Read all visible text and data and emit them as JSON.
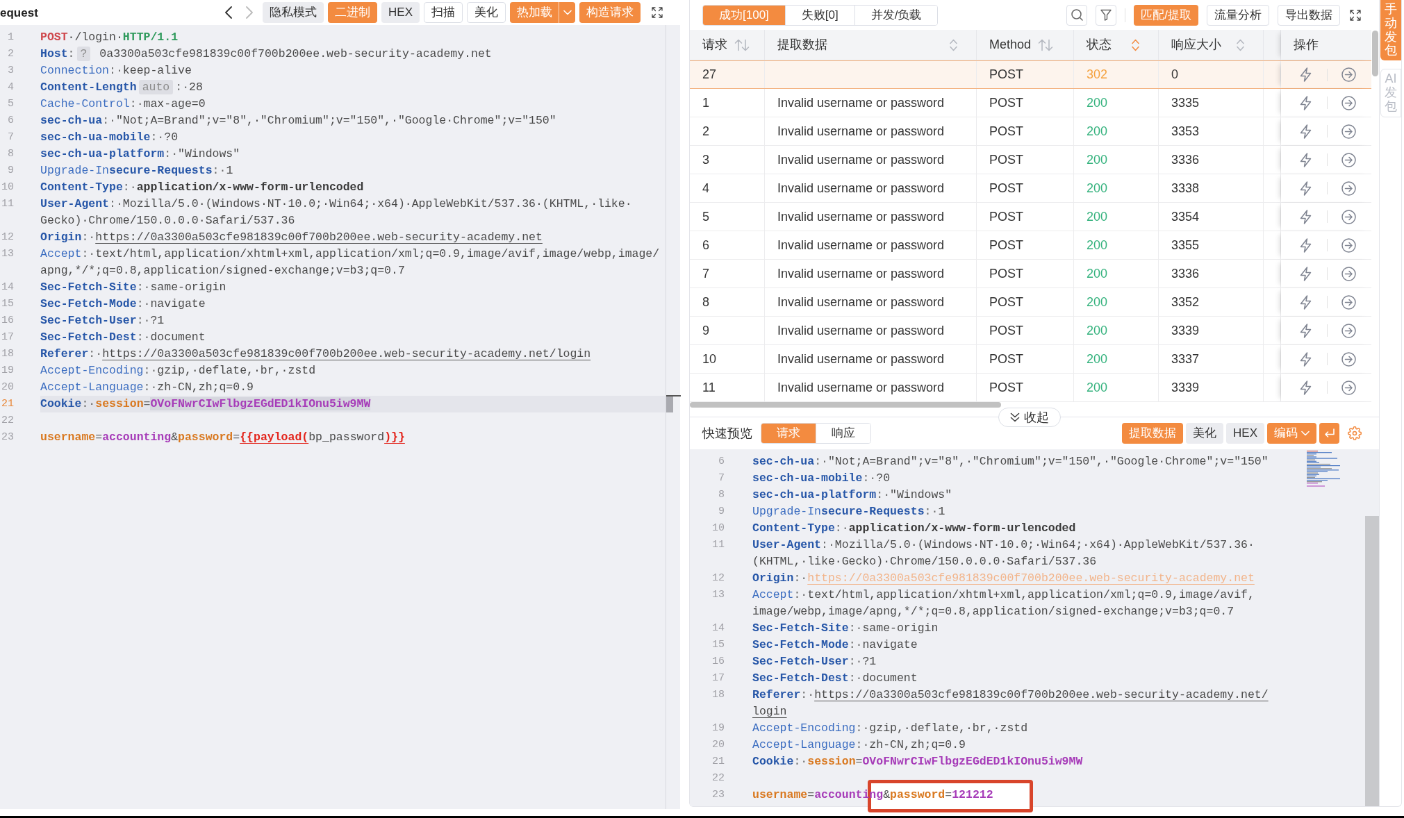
{
  "request_editor": {
    "title": "equest",
    "history": {
      "back_enabled": true,
      "forward_enabled": false
    },
    "toolbar": [
      {
        "label": "隐私模式",
        "kind": "gray"
      },
      {
        "label": "二进制",
        "kind": "primary"
      },
      {
        "label": "HEX",
        "kind": "gray"
      },
      {
        "label": "扫描",
        "kind": "outline"
      },
      {
        "label": "美化",
        "kind": "outline"
      },
      {
        "label": "热加载",
        "kind": "split"
      },
      {
        "label": "构造请求",
        "kind": "primary"
      }
    ],
    "lines": [
      {
        "number": "1",
        "active": false,
        "rows": [
          [
            {
              "text": "POST",
              "kind": "method"
            },
            {
              "text": "·/login·",
              "kind": "text"
            },
            {
              "text": "HTTP/1.1",
              "kind": "version"
            }
          ]
        ]
      },
      {
        "number": "2",
        "active": false,
        "rows": [
          [
            {
              "text": "Host",
              "kind": "keybold"
            },
            {
              "text": ":",
              "kind": "punct"
            },
            {
              "text": "?",
              "kind": "chip"
            },
            {
              "text": " 0a3300a503cfe981839c00f700b200ee.web-security-academy.net",
              "kind": "text"
            }
          ]
        ]
      },
      {
        "number": "3",
        "active": false,
        "rows": [
          [
            {
              "text": "Connection",
              "kind": "key"
            },
            {
              "text": ":·",
              "kind": "punct"
            },
            {
              "text": "keep-alive",
              "kind": "text"
            }
          ]
        ]
      },
      {
        "number": "4",
        "active": false,
        "rows": [
          [
            {
              "text": "Content-Length",
              "kind": "keybold"
            },
            {
              "text": "auto",
              "kind": "chip"
            },
            {
              "text": ":·",
              "kind": "punct"
            },
            {
              "text": "28",
              "kind": "text"
            }
          ]
        ]
      },
      {
        "number": "5",
        "active": false,
        "rows": [
          [
            {
              "text": "Cache-Control",
              "kind": "key"
            },
            {
              "text": ":·",
              "kind": "punct"
            },
            {
              "text": "max-age=0",
              "kind": "text"
            }
          ]
        ]
      },
      {
        "number": "6",
        "active": false,
        "rows": [
          [
            {
              "text": "sec-ch-ua",
              "kind": "keybold"
            },
            {
              "text": ":·",
              "kind": "punct"
            },
            {
              "text": "\"Not;A=Brand\";v=\"8\",·\"Chromium\";v=\"150\",·\"Google·Chrome\";v=\"150\"",
              "kind": "text"
            }
          ]
        ]
      },
      {
        "number": "7",
        "active": false,
        "rows": [
          [
            {
              "text": "sec-ch-ua-mobile",
              "kind": "keybold"
            },
            {
              "text": ":·",
              "kind": "punct"
            },
            {
              "text": "?0",
              "kind": "text"
            }
          ]
        ]
      },
      {
        "number": "8",
        "active": false,
        "rows": [
          [
            {
              "text": "sec-ch-ua-platform",
              "kind": "keybold"
            },
            {
              "text": ":·",
              "kind": "punct"
            },
            {
              "text": "\"Windows\"",
              "kind": "text"
            }
          ]
        ]
      },
      {
        "number": "9",
        "active": false,
        "rows": [
          [
            {
              "text": "Upgrade-In",
              "kind": "key"
            },
            {
              "text": "secure-Requests",
              "kind": "keybold"
            },
            {
              "text": ":·",
              "kind": "punct"
            },
            {
              "text": "1",
              "kind": "text"
            }
          ]
        ]
      },
      {
        "number": "10",
        "active": false,
        "rows": [
          [
            {
              "text": "Content-Type",
              "kind": "keybold"
            },
            {
              "text": ":·",
              "kind": "punct"
            },
            {
              "text": "application/x-www-form-urlencoded",
              "kind": "strong"
            }
          ]
        ]
      },
      {
        "number": "11",
        "active": false,
        "rows": [
          [
            {
              "text": "User-Agent",
              "kind": "keybold"
            },
            {
              "text": ":·",
              "kind": "punct"
            },
            {
              "text": "Mozilla/5.0·(Windows·NT·10.0;·Win64;·x64)·AppleWebKit/537.36·(KHTML,·like·",
              "kind": "text"
            }
          ],
          [
            {
              "text": "Gecko)·Chrome/150.0.0.0·Safari/537.36",
              "kind": "text"
            }
          ]
        ]
      },
      {
        "number": "12",
        "active": false,
        "rows": [
          [
            {
              "text": "Origin",
              "kind": "keybold"
            },
            {
              "text": ":·",
              "kind": "punct"
            },
            {
              "text": "https://0a3300a503cfe981839c00f700b200ee.web-security-academy.net",
              "kind": "link"
            }
          ]
        ]
      },
      {
        "number": "13",
        "active": false,
        "rows": [
          [
            {
              "text": "Accept",
              "kind": "key"
            },
            {
              "text": ":·",
              "kind": "punct"
            },
            {
              "text": "text/html,application/xhtml+xml,application/xml;q=0.9,image/avif,image/webp,image/",
              "kind": "text"
            }
          ],
          [
            {
              "text": "apng,*/*;q=0.8,application/signed-exchange;v=b3;q=0.7",
              "kind": "text"
            }
          ]
        ]
      },
      {
        "number": "14",
        "active": false,
        "rows": [
          [
            {
              "text": "Sec-Fetch-Site",
              "kind": "keybold"
            },
            {
              "text": ":·",
              "kind": "punct"
            },
            {
              "text": "same-origin",
              "kind": "text"
            }
          ]
        ]
      },
      {
        "number": "15",
        "active": false,
        "rows": [
          [
            {
              "text": "Sec-Fetch-Mode",
              "kind": "keybold"
            },
            {
              "text": ":·",
              "kind": "punct"
            },
            {
              "text": "navigate",
              "kind": "text"
            }
          ]
        ]
      },
      {
        "number": "16",
        "active": false,
        "rows": [
          [
            {
              "text": "Sec-Fetch-User",
              "kind": "keybold"
            },
            {
              "text": ":·",
              "kind": "punct"
            },
            {
              "text": "?1",
              "kind": "text"
            }
          ]
        ]
      },
      {
        "number": "17",
        "active": false,
        "rows": [
          [
            {
              "text": "Sec-Fetch-Dest",
              "kind": "keybold"
            },
            {
              "text": ":·",
              "kind": "punct"
            },
            {
              "text": "document",
              "kind": "text"
            }
          ]
        ]
      },
      {
        "number": "18",
        "active": false,
        "rows": [
          [
            {
              "text": "Referer",
              "kind": "keybold"
            },
            {
              "text": ":·",
              "kind": "punct"
            },
            {
              "text": "https://0a3300a503cfe981839c00f700b200ee.web-security-academy.net/login",
              "kind": "link"
            }
          ]
        ]
      },
      {
        "number": "19",
        "active": false,
        "rows": [
          [
            {
              "text": "Accept-Encoding",
              "kind": "key"
            },
            {
              "text": ":·",
              "kind": "punct"
            },
            {
              "text": "gzip,·deflate,·br,·zstd",
              "kind": "text"
            }
          ]
        ]
      },
      {
        "number": "20",
        "active": false,
        "rows": [
          [
            {
              "text": "Accept-Language",
              "kind": "key"
            },
            {
              "text": ":·",
              "kind": "punct"
            },
            {
              "text": "zh-CN,zh;q=0.9",
              "kind": "text"
            }
          ]
        ]
      },
      {
        "number": "21",
        "active": true,
        "rows": [
          [
            {
              "text": "Cookie",
              "kind": "keybold"
            },
            {
              "text": ":·",
              "kind": "punct"
            },
            {
              "text": "session",
              "kind": "param"
            },
            {
              "text": "=",
              "kind": "punct"
            },
            {
              "text": "OVoFNwrCIwFlbgzEGdED1kIOnu5iw9MW",
              "kind": "selected"
            }
          ]
        ]
      },
      {
        "number": "22",
        "active": false
      },
      {
        "number": "23",
        "active": false,
        "rows": [
          [
            {
              "text": "username",
              "kind": "param"
            },
            {
              "text": "=",
              "kind": "punct"
            },
            {
              "text": "accounting",
              "kind": "pvalue"
            },
            {
              "text": "&",
              "kind": "text"
            },
            {
              "text": "password",
              "kind": "param"
            },
            {
              "text": "=",
              "kind": "punct"
            },
            {
              "text": "{{payload(",
              "kind": "template"
            },
            {
              "text": "bp_password",
              "kind": "text"
            },
            {
              "text": ")}}",
              "kind": "template"
            }
          ]
        ]
      }
    ]
  },
  "results": {
    "tabs": [
      {
        "label": "成功[100]",
        "selected": true
      },
      {
        "label": "失败[0]",
        "selected": false
      },
      {
        "label": "并发/负载",
        "selected": false
      }
    ],
    "actions": [
      {
        "label": "匹配/提取",
        "kind": "primary"
      },
      {
        "label": "流量分析",
        "kind": "outline"
      },
      {
        "label": "导出数据",
        "kind": "outline"
      }
    ],
    "table": {
      "columns": [
        {
          "label": "请求",
          "kind": "arrows",
          "sorted": false
        },
        {
          "label": "提取数据",
          "kind": "chevrons",
          "sorted": false
        },
        {
          "label": "Method",
          "kind": "arrows",
          "sorted": false
        },
        {
          "label": "状态",
          "kind": "chevrons",
          "sorted": true
        },
        {
          "label": "响应大小",
          "kind": "chevrons",
          "sorted": false
        },
        {
          "label": "操作",
          "kind": "plain"
        }
      ],
      "rows": [
        {
          "request": "27",
          "method": "POST",
          "status": {
            "text": "302",
            "color": "#f5a23f"
          },
          "size": "0",
          "selected": true
        },
        {
          "request": "1",
          "extracted": "Invalid username or password",
          "method": "POST",
          "status": {
            "text": "200",
            "color": "#34b27d"
          },
          "size": "3335",
          "selected": false
        },
        {
          "request": "2",
          "extracted": "Invalid username or password",
          "method": "POST",
          "status": {
            "text": "200",
            "color": "#34b27d"
          },
          "size": "3353",
          "selected": false
        },
        {
          "request": "3",
          "extracted": "Invalid username or password",
          "method": "POST",
          "status": {
            "text": "200",
            "color": "#34b27d"
          },
          "size": "3336",
          "selected": false
        },
        {
          "request": "4",
          "extracted": "Invalid username or password",
          "method": "POST",
          "status": {
            "text": "200",
            "color": "#34b27d"
          },
          "size": "3338",
          "selected": false
        },
        {
          "request": "5",
          "extracted": "Invalid username or password",
          "method": "POST",
          "status": {
            "text": "200",
            "color": "#34b27d"
          },
          "size": "3354",
          "selected": false
        },
        {
          "request": "6",
          "extracted": "Invalid username or password",
          "method": "POST",
          "status": {
            "text": "200",
            "color": "#34b27d"
          },
          "size": "3355",
          "selected": false
        },
        {
          "request": "7",
          "extracted": "Invalid username or password",
          "method": "POST",
          "status": {
            "text": "200",
            "color": "#34b27d"
          },
          "size": "3336",
          "selected": false
        },
        {
          "request": "8",
          "extracted": "Invalid username or password",
          "method": "POST",
          "status": {
            "text": "200",
            "color": "#34b27d"
          },
          "size": "3352",
          "selected": false
        },
        {
          "request": "9",
          "extracted": "Invalid username or password",
          "method": "POST",
          "status": {
            "text": "200",
            "color": "#34b27d"
          },
          "size": "3339",
          "selected": false
        },
        {
          "request": "10",
          "extracted": "Invalid username or password",
          "method": "POST",
          "status": {
            "text": "200",
            "color": "#34b27d"
          },
          "size": "3337",
          "selected": false
        },
        {
          "request": "11",
          "extracted": "Invalid username or password",
          "method": "POST",
          "status": {
            "text": "200",
            "color": "#34b27d"
          },
          "size": "3339",
          "selected": false
        }
      ]
    }
  },
  "side_tabs": [
    {
      "label": "手动发包",
      "selected": true
    },
    {
      "label": "AI发包",
      "selected": false
    }
  ],
  "collapse_button": {
    "label": "收起"
  },
  "preview": {
    "title": "快速预览",
    "tabs": [
      {
        "label": "请求",
        "selected": true
      },
      {
        "label": "响应",
        "selected": false
      }
    ],
    "actions": [
      {
        "label": "提取数据",
        "kind": "primary"
      },
      {
        "label": "美化",
        "kind": "gray"
      },
      {
        "label": "HEX",
        "kind": "gray"
      },
      {
        "label": "编码",
        "kind": "dropdown"
      }
    ],
    "lines": [
      {
        "number": "6",
        "active": false,
        "rows": [
          [
            {
              "text": "sec-ch-ua",
              "kind": "keybold"
            },
            {
              "text": ":·",
              "kind": "punct"
            },
            {
              "text": "\"Not;A=Brand\";v=\"8\",·\"Chromium\";v=\"150\",·\"Google·Chrome\";v=\"150\"",
              "kind": "text"
            }
          ]
        ]
      },
      {
        "number": "7",
        "active": false,
        "rows": [
          [
            {
              "text": "sec-ch-ua-mobile",
              "kind": "keybold"
            },
            {
              "text": ":·",
              "kind": "punct"
            },
            {
              "text": "?0",
              "kind": "text"
            }
          ]
        ]
      },
      {
        "number": "8",
        "active": false,
        "rows": [
          [
            {
              "text": "sec-ch-ua-platform",
              "kind": "keybold"
            },
            {
              "text": ":·",
              "kind": "punct"
            },
            {
              "text": "\"Windows\"",
              "kind": "text"
            }
          ]
        ]
      },
      {
        "number": "9",
        "active": false,
        "rows": [
          [
            {
              "text": "Upgrade-In",
              "kind": "key"
            },
            {
              "text": "secure-Requests",
              "kind": "keybold"
            },
            {
              "text": ":·",
              "kind": "punct"
            },
            {
              "text": "1",
              "kind": "text"
            }
          ]
        ]
      },
      {
        "number": "10",
        "active": false,
        "rows": [
          [
            {
              "text": "Content-Type",
              "kind": "keybold"
            },
            {
              "text": ":·",
              "kind": "punct"
            },
            {
              "text": "application/x-www-form-urlencoded",
              "kind": "strong"
            }
          ]
        ]
      },
      {
        "number": "11",
        "active": false,
        "rows": [
          [
            {
              "text": "User-Agent",
              "kind": "keybold"
            },
            {
              "text": ":·",
              "kind": "punct"
            },
            {
              "text": "Mozilla/5.0·(Windows·NT·10.0;·Win64;·x64)·AppleWebKit/537.36·",
              "kind": "text"
            }
          ],
          [
            {
              "text": "(KHTML,·like·Gecko)·Chrome/150.0.0.0·Safari/537.36",
              "kind": "text"
            }
          ]
        ]
      },
      {
        "number": "12",
        "active": false,
        "rows": [
          [
            {
              "text": "Origin",
              "kind": "keybold"
            },
            {
              "text": ":·",
              "kind": "punct"
            },
            {
              "text": "https://0a3300a503cfe981839c00f700b200ee.web-security-academy.net",
              "kind": "faintlink"
            }
          ]
        ]
      },
      {
        "number": "13",
        "active": false,
        "rows": [
          [
            {
              "text": "Accept",
              "kind": "key"
            },
            {
              "text": ":·",
              "kind": "punct"
            },
            {
              "text": "text/html,application/xhtml+xml,application/xml;q=0.9,image/avif,",
              "kind": "text"
            }
          ],
          [
            {
              "text": "image/webp,image/apng,*/*;q=0.8,application/signed-exchange;v=b3;q=0.7",
              "kind": "text"
            }
          ]
        ]
      },
      {
        "number": "14",
        "active": false,
        "rows": [
          [
            {
              "text": "Sec-Fetch-Site",
              "kind": "keybold"
            },
            {
              "text": ":·",
              "kind": "punct"
            },
            {
              "text": "same-origin",
              "kind": "text"
            }
          ]
        ]
      },
      {
        "number": "15",
        "active": false,
        "rows": [
          [
            {
              "text": "Sec-Fetch-Mode",
              "kind": "keybold"
            },
            {
              "text": ":·",
              "kind": "punct"
            },
            {
              "text": "navigate",
              "kind": "text"
            }
          ]
        ]
      },
      {
        "number": "16",
        "active": false,
        "rows": [
          [
            {
              "text": "Sec-Fetch-User",
              "kind": "keybold"
            },
            {
              "text": ":·",
              "kind": "punct"
            },
            {
              "text": "?1",
              "kind": "text"
            }
          ]
        ]
      },
      {
        "number": "17",
        "active": false,
        "rows": [
          [
            {
              "text": "Sec-Fetch-Dest",
              "kind": "keybold"
            },
            {
              "text": ":·",
              "kind": "punct"
            },
            {
              "text": "document",
              "kind": "text"
            }
          ]
        ]
      },
      {
        "number": "18",
        "active": false,
        "rows": [
          [
            {
              "text": "Referer",
              "kind": "keybold"
            },
            {
              "text": ":·",
              "kind": "punct"
            },
            {
              "text": "https://0a3300a503cfe981839c00f700b200ee.web-security-academy.net/",
              "kind": "link"
            }
          ],
          [
            {
              "text": "login",
              "kind": "link"
            }
          ]
        ]
      },
      {
        "number": "19",
        "active": false,
        "rows": [
          [
            {
              "text": "Accept-Encoding",
              "kind": "key"
            },
            {
              "text": ":·",
              "kind": "punct"
            },
            {
              "text": "gzip,·deflate,·br,·zstd",
              "kind": "text"
            }
          ]
        ]
      },
      {
        "number": "20",
        "active": false,
        "rows": [
          [
            {
              "text": "Accept-Language",
              "kind": "key"
            },
            {
              "text": ":·",
              "kind": "punct"
            },
            {
              "text": "zh-CN,zh;q=0.9",
              "kind": "text"
            }
          ]
        ]
      },
      {
        "number": "21",
        "active": false,
        "rows": [
          [
            {
              "text": "Cookie",
              "kind": "keybold"
            },
            {
              "text": ":·",
              "kind": "punct"
            },
            {
              "text": "session",
              "kind": "param"
            },
            {
              "text": "=",
              "kind": "punct"
            },
            {
              "text": "OVoFNwrCIwFlbgzEGdED1kIOnu5iw9MW",
              "kind": "pvalue"
            }
          ]
        ]
      },
      {
        "number": "22",
        "active": false
      },
      {
        "number": "23",
        "active": false,
        "rows": [
          [
            {
              "text": "username",
              "kind": "param"
            },
            {
              "text": "=",
              "kind": "punct"
            },
            {
              "text": "accounting",
              "kind": "pvalue"
            },
            {
              "text": "&",
              "kind": "text"
            },
            {
              "text": "password",
              "kind": "param"
            },
            {
              "text": "=",
              "kind": "punct"
            },
            {
              "text": "121212",
              "kind": "pvalue"
            }
          ]
        ]
      }
    ]
  }
}
